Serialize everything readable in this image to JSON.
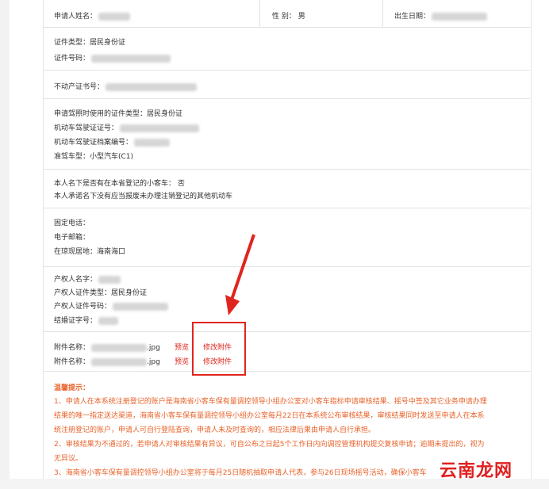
{
  "header": {
    "applicant_label": "申请人姓名：",
    "gender_label": "性 别：",
    "gender_value": "男",
    "birthdate_label": "出生日期："
  },
  "identity": {
    "id_type_label": "证件类型：",
    "id_type_value": "居民身份证",
    "id_number_label": "证件号码："
  },
  "property": {
    "cert_label": "不动产证书号："
  },
  "license": {
    "license_id_type_label": "申请驾照时使用的证件类型：",
    "license_id_type_value": "居民身份证",
    "license_no_label": "机动车驾驶证证号：",
    "license_file_label": "机动车驾驶证档案编号：",
    "vehicle_class_label": "准驾车型：",
    "vehicle_class_value": "小型汽车(C1)"
  },
  "registration": {
    "has_car_label": "本人名下是否有在本省登记的小客车：",
    "has_car_value": "否",
    "pledge_text": "本人承诺名下没有应当报废未办理注销登记的其他机动车"
  },
  "contact": {
    "phone_label": "固定电话：",
    "email_label": "电子邮箱：",
    "residence_label": "在琼现居地：",
    "residence_value": "海南海口"
  },
  "owner": {
    "owner_name_label": "产权人名字：",
    "owner_id_type_label": "产权人证件类型：",
    "owner_id_type_value": "居民身份证",
    "owner_id_number_label": "产权人证件号码：",
    "marriage_cert_label": "结婚证字号："
  },
  "attachments": [
    {
      "label": "附件名称：",
      "suffix": ".jpg",
      "preview": "预览",
      "modify": "修改附件"
    },
    {
      "label": "附件名称：",
      "suffix": ".jpg",
      "preview": "预览",
      "modify": "修改附件"
    }
  ],
  "tips": {
    "title": "温馨提示：",
    "lines": [
      "1、申请人在本系统注册登记的账户是海南省小客车保有量调控领导小组办公室对小客车指标申请审核结果、摇号中签及其它业务申请办理",
      "结果的唯一指定送达渠道，海南省小客车保有量调控领导小组办公室每月22日在本系统公布审核结果，审核结果同时发送至申请人在本系",
      "统注册登记的账户，申请人可自行登陆查询，申请人未及时查询的，相应法律后果由申请人自行承担。",
      "2、审核结果为不通过的，若申请人对审核结果有异议，可自公布之日起5个工作日内向调控管理机构提交复核申请；逾期未提出的，视为",
      "无异议。",
      "3、海南省小客车保有量调控领导小组办公室将于每月25日随机抽取申请人代表，参与26日现场摇号活动，确保小客车"
    ]
  },
  "watermark": "云南龙网"
}
